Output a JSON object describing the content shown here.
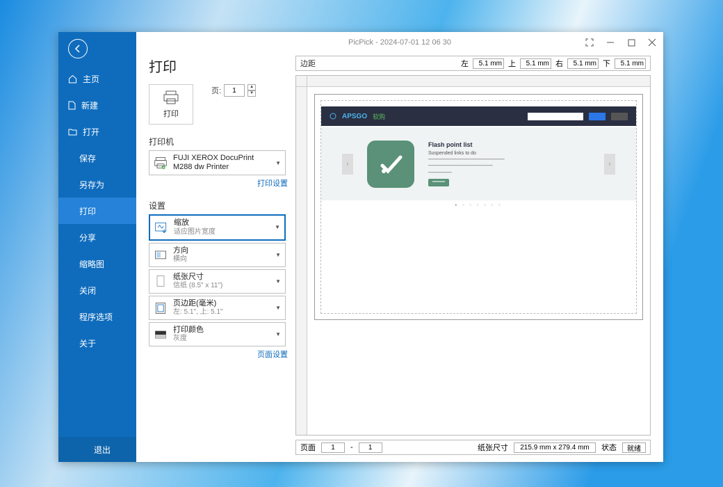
{
  "window": {
    "title": "PicPick - 2024-07-01 12 06 30"
  },
  "sidebar": {
    "home": "主页",
    "new": "新建",
    "open": "打开",
    "save": "保存",
    "saveas": "另存为",
    "print": "打印",
    "share": "分享",
    "thumb": "缩略图",
    "close": "关闭",
    "options": "程序选项",
    "about": "关于",
    "exit": "退出"
  },
  "page": {
    "title": "打印",
    "print_btn": "打印",
    "pages_label": "页:",
    "pages_value": "1"
  },
  "printer": {
    "section": "打印机",
    "name": "FUJI XEROX DocuPrint M288 dw Printer",
    "settings_link": "打印设置"
  },
  "settings": {
    "section": "设置",
    "zoom": {
      "title": "缩放",
      "sub": "适应图片宽度"
    },
    "orient": {
      "title": "方向",
      "sub": "横向"
    },
    "size": {
      "title": "纸张尺寸",
      "sub": "信纸 (8.5\" x 11\")"
    },
    "margin": {
      "title": "页边距(毫米)",
      "sub": "左: 5.1\", 上: 5.1\""
    },
    "color": {
      "title": "打印颜色",
      "sub": "灰度"
    },
    "page_link": "页面设置"
  },
  "margins": {
    "label": "边距",
    "left_l": "左",
    "left_v": "5.1 mm",
    "top_l": "上",
    "top_v": "5.1 mm",
    "right_l": "右",
    "right_v": "5.1 mm",
    "bottom_l": "下",
    "bottom_v": "5.1 mm"
  },
  "status": {
    "page_l": "页面",
    "page_from": "1",
    "page_to": "1",
    "paper_l": "纸张尺寸",
    "paper_v": "215.9 mm x 279.4 mm",
    "state_l": "状态",
    "state_v": "就绪"
  },
  "mock": {
    "logo": "APSGO",
    "title": "Flash point list",
    "sub": "Suspended links to do"
  }
}
